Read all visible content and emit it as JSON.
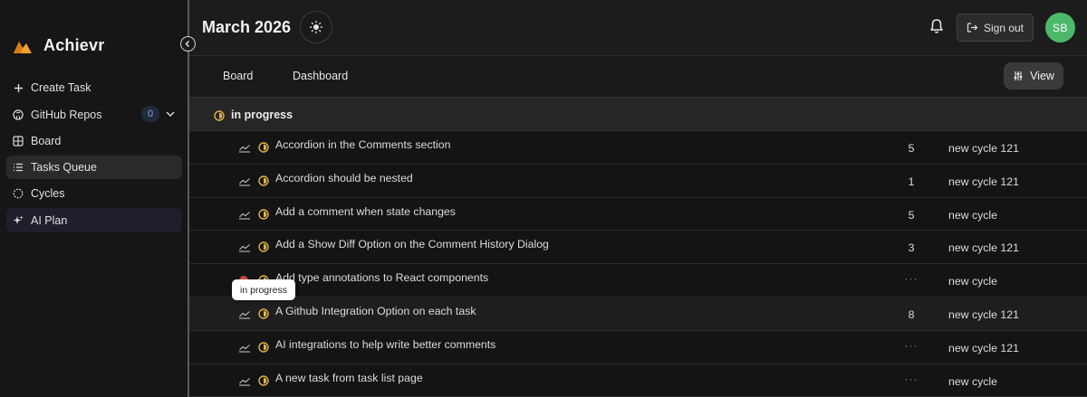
{
  "app": {
    "name": "Achievr"
  },
  "sidebar": {
    "items": [
      {
        "label": "Create Task",
        "icon": "plus-icon"
      },
      {
        "label": "GitHub Repos",
        "icon": "github-icon",
        "badge": "0"
      },
      {
        "label": "Board",
        "icon": "board-icon"
      },
      {
        "label": "Tasks Queue",
        "icon": "list-icon",
        "active": true
      },
      {
        "label": "Cycles",
        "icon": "cycle-icon"
      },
      {
        "label": "AI Plan",
        "icon": "sparkle-icon"
      }
    ]
  },
  "header": {
    "title": "March 2026",
    "signout_label": "Sign out",
    "avatar_initials": "SB"
  },
  "tabs": [
    {
      "label": "Board"
    },
    {
      "label": "Dashboard"
    }
  ],
  "view_button": {
    "label": "View"
  },
  "group": {
    "label": "in progress",
    "status_color": "#e0b340"
  },
  "tooltip": {
    "text": "in progress"
  },
  "tasks": [
    {
      "title": "Accordion in the Comments section",
      "points": "5",
      "cycle": "new cycle 121"
    },
    {
      "title": "Accordion should be nested",
      "points": "1",
      "cycle": "new cycle 121"
    },
    {
      "title": "Add a comment when state changes",
      "points": "5",
      "cycle": "new cycle"
    },
    {
      "title": "Add a Show Diff Option on the Comment History Dialog",
      "points": "3",
      "cycle": "new cycle 121"
    },
    {
      "title": "Add type annotations to React components",
      "points": "···",
      "cycle": "new cycle"
    },
    {
      "title": "A Github Integration Option on each task",
      "points": "8",
      "cycle": "new cycle 121"
    },
    {
      "title": "AI integrations to help write better comments",
      "points": "···",
      "cycle": "new cycle 121"
    },
    {
      "title": "A new task from task list page",
      "points": "···",
      "cycle": "new cycle"
    }
  ],
  "colors": {
    "accent_green": "#4cb86a",
    "status_yellow": "#e0b340",
    "urgent_red": "#d24848",
    "logo_orange": "#f0a030"
  }
}
